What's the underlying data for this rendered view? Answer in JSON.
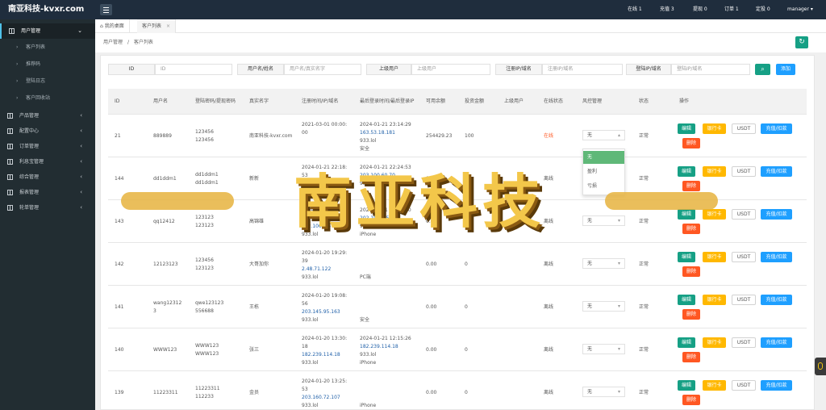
{
  "app": {
    "title": "南亚科技-kvxr.com"
  },
  "topbar": {
    "online": "在线 1",
    "recharge": "充值 3",
    "withdraw": "提现 0",
    "orders": "订单 1",
    "risk": "定投 0",
    "user": "manager"
  },
  "sidebar": {
    "user_mgmt": "用户管理",
    "sub": [
      "客户列表",
      "推荐码",
      "登陆日志",
      "客户回收站"
    ],
    "groups": [
      "产品管理",
      "配置中心",
      "订单管理",
      "利息宝管理",
      "综合管理",
      "报表管理",
      "轮单管理"
    ]
  },
  "tabs": {
    "home": "我的桌面",
    "current": "客户列表",
    "close": "×"
  },
  "breadcrumb": {
    "parent": "用户管理",
    "sep": "/",
    "current": "客户列表"
  },
  "filters": {
    "id_label": "ID",
    "id_placeholder": "ID",
    "name_label": "用户名/姓名",
    "name_placeholder": "用户名/真实名字",
    "parent_label": "上级用户",
    "parent_placeholder": "上级用户",
    "reg_label": "注册IP/域名",
    "reg_placeholder": "注册IP/域名",
    "login_label": "登陆IP/域名",
    "login_placeholder": "登陆IP/域名",
    "add": "添加"
  },
  "columns": [
    "ID",
    "用户名",
    "登陆密码/提现密码",
    "真实名字",
    "注册时间/IP/域名",
    "最后登录时间/最后登录IP",
    "可用余额",
    "投资金额",
    "上级用户",
    "在线状态",
    "风控管理",
    "状态",
    "操作"
  ],
  "actions": {
    "edit": "编辑",
    "card": "银行卡",
    "usdt": "USDT",
    "charge": "充值/扣款",
    "delete": "删除"
  },
  "risk_options": [
    "无",
    "盈利",
    "亏损"
  ],
  "rows": [
    {
      "id": "21",
      "user": "889889",
      "pw1": "123456",
      "pw2": "123456",
      "name": "南亚科技-kvxr.com",
      "reg1": "2021-03-01 00:00:",
      "reg2": "00",
      "reg3": "",
      "reg4": "",
      "last1": "2024-01-21 23:14:29",
      "last2": "163.53.18.181",
      "last3": "933.lol",
      "last4": "安全",
      "bal": "254429.23",
      "inv": "100",
      "parent": "",
      "online": "在线",
      "risk": "无",
      "status": "正常"
    },
    {
      "id": "144",
      "user": "dd1ddm1",
      "pw1": "dd1ddm1",
      "pw2": "dd1ddm1",
      "name": "新新",
      "reg1": "2024-01-21 22:18:",
      "reg2": "53",
      "reg3": "203.100.60.54",
      "reg4": "933.lol",
      "last1": "2024-01-21 22:24:53",
      "last2": "203.100.60.70",
      "last3": "933.lol",
      "last4": "",
      "bal": "0.00",
      "inv": "0",
      "parent": "",
      "online": "离线",
      "risk": "无",
      "status": "正常"
    },
    {
      "id": "143",
      "user": "qq12412",
      "pw1": "123123",
      "pw2": "123123",
      "name": "高锦雄",
      "reg1": "2024-01-21 21:54:",
      "reg2": "32",
      "reg3": "202.100.3.5",
      "reg4": "933.lol",
      "last1": "2024-01-21 22:15:30",
      "last2": "202.100.3.5",
      "last3": "933.lol",
      "last4": "iPhone",
      "bal": "0.00",
      "inv": "0",
      "parent": "",
      "online": "离线",
      "risk": "无",
      "status": "正常"
    },
    {
      "id": "142",
      "user": "12123123",
      "pw1": "123456",
      "pw2": "123123",
      "name": "大哥加你",
      "reg1": "2024-01-20 19:29:",
      "reg2": "39",
      "reg3": "2.48.71.122",
      "reg4": "933.lol",
      "last1": "",
      "last2": "",
      "last3": "",
      "last4": "PC端",
      "bal": "0.00",
      "inv": "0",
      "parent": "",
      "online": "离线",
      "risk": "无",
      "status": "正常"
    },
    {
      "id": "141",
      "user": "wang12312",
      "user2": "3",
      "pw1": "qwe123123",
      "pw2": "556688",
      "name": "王栋",
      "reg1": "2024-01-20 19:08:",
      "reg2": "56",
      "reg3": "203.145.95.163",
      "reg4": "933.lol",
      "last1": "",
      "last2": "",
      "last3": "",
      "last4": "安全",
      "bal": "0.00",
      "inv": "0",
      "parent": "",
      "online": "离线",
      "risk": "无",
      "status": "正常"
    },
    {
      "id": "140",
      "user": "WWW123",
      "pw1": "WWW123",
      "pw2": "WWW123",
      "name": "张三",
      "reg1": "2024-01-20 13:30:",
      "reg2": "18",
      "reg3": "182.239.114.18",
      "reg4": "933.lol",
      "last1": "2024-01-21 12:15:26",
      "last2": "182.239.114.18",
      "last3": "933.lol",
      "last4": "iPhone",
      "bal": "0.00",
      "inv": "0",
      "parent": "",
      "online": "离线",
      "risk": "无",
      "status": "正常"
    },
    {
      "id": "139",
      "user": "11223311",
      "pw1": "11223311",
      "pw2": "112233",
      "name": "金员",
      "reg1": "2024-01-20 13:25:",
      "reg2": "53",
      "reg3": "203.160.72.107",
      "reg4": "933.lol",
      "last1": "",
      "last2": "",
      "last3": "",
      "last4": "iPhone",
      "bal": "0.00",
      "inv": "0",
      "parent": "",
      "online": "离线",
      "risk": "无",
      "status": "正常"
    }
  ],
  "watermark": {
    "text": "南亚科技"
  },
  "colors": {
    "topbar": "#1f2d3d",
    "sidebar": "#222d32",
    "primary": "#16a085",
    "warn": "#ffb800",
    "blue": "#1e9fff",
    "danger": "#ff5722"
  }
}
